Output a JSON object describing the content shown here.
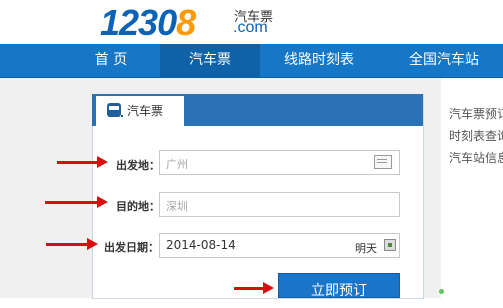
{
  "header": {
    "logo_number_a": "1230",
    "logo_number_b": "8",
    "logo_suffix_cn": "汽车票",
    "logo_suffix_domain": ".com"
  },
  "nav": {
    "items": [
      {
        "label": "首 页"
      },
      {
        "label": "汽车票"
      },
      {
        "label": "线路时刻表"
      },
      {
        "label": "全国汽车站"
      }
    ]
  },
  "search_panel": {
    "tab_label": "汽车票",
    "departure_label": "出发地：",
    "departure_value": "广州",
    "destination_label": "目的地：",
    "destination_value": "深圳",
    "date_label": "出发日期：",
    "date_value": "2014-08-14",
    "date_hint": "明天",
    "submit_label": "立即预订"
  },
  "sidebar": {
    "lines": [
      "汽车票预订",
      "时刻表查询",
      "汽车站信息"
    ]
  },
  "colors": {
    "nav_bg": "#1677c6",
    "nav_active": "#0f62a8",
    "brand_blue": "#0b63b8",
    "brand_orange": "#ff9900",
    "annotation_arrow": "#d80e0e"
  }
}
